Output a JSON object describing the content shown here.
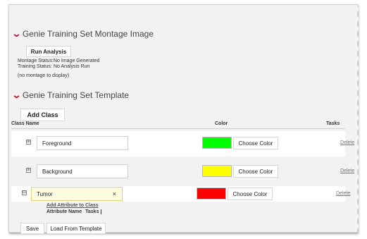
{
  "montage": {
    "title": "Genie Training Set Montage Image",
    "run_button": "Run Analysis",
    "montage_status_label": "Montage Status:",
    "montage_status_value": "No Image Generated",
    "training_status_label": "Training Status:",
    "training_status_value": "No Analysis Run",
    "no_montage": "(no montage to display)"
  },
  "template": {
    "title": "Genie Training Set Template",
    "add_class_button": "Add Class",
    "columns": {
      "class_name": "Class Name",
      "color": "Color",
      "tasks": "Tasks"
    },
    "rows": [
      {
        "name": "Foreground",
        "color": "#00ff00",
        "choose_label": "Choose Color",
        "delete_label": "Delete",
        "expander": "⊞"
      },
      {
        "name": "Background",
        "color": "#ffff00",
        "choose_label": "Choose Color",
        "delete_label": "Delete",
        "expander": "⊞"
      },
      {
        "name": "Tumor",
        "color": "#ff0000",
        "choose_label": "Choose Color",
        "delete_label": "Delete",
        "expander": "⊟",
        "clear": "×"
      }
    ],
    "add_attribute_link": "Add Attribute to Class",
    "attribute_columns": {
      "name": "Attribute Name",
      "tasks": "Tasks"
    }
  },
  "footer": {
    "save": "Save",
    "load_template": "Load From Template"
  }
}
